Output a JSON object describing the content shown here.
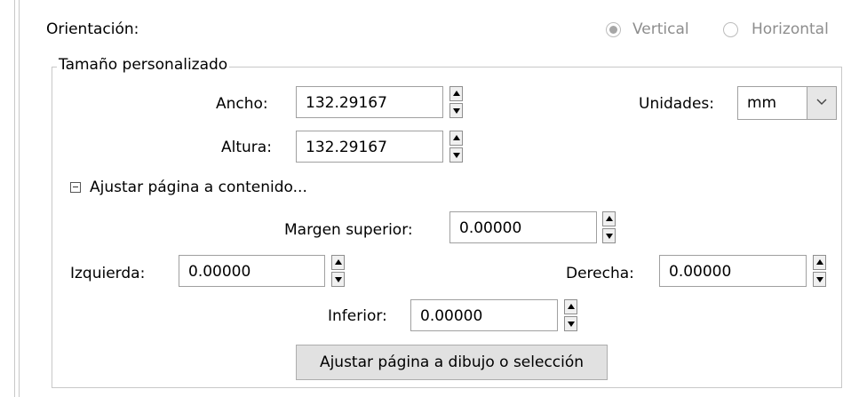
{
  "orientation": {
    "label": "Orientación:",
    "options": [
      {
        "label": "Vertical",
        "selected": true
      },
      {
        "label": "Horizontal",
        "selected": false
      }
    ]
  },
  "custom_size": {
    "legend": "Tamaño personalizado",
    "width": {
      "label": "Ancho:",
      "value": "132.29167"
    },
    "height": {
      "label": "Altura:",
      "value": "132.29167"
    },
    "units": {
      "label": "Unidades:",
      "value": "mm"
    }
  },
  "fit_content": {
    "label": "Ajustar página a contenido...",
    "top": {
      "label": "Margen superior:",
      "value": "0.00000"
    },
    "left": {
      "label": "Izquierda:",
      "value": "0.00000"
    },
    "right": {
      "label": "Derecha:",
      "value": "0.00000"
    },
    "bottom": {
      "label": "Inferior:",
      "value": "0.00000"
    },
    "button": "Ajustar página a dibujo o selección"
  }
}
